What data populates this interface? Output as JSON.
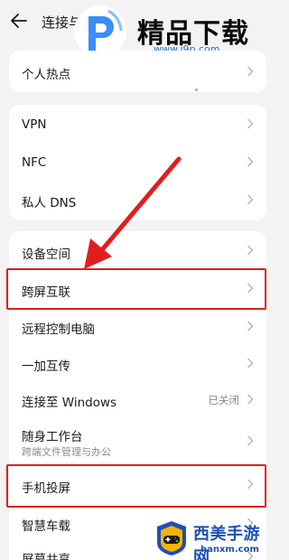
{
  "header": {
    "title": "连接与共享",
    "back_icon": "back-arrow-icon"
  },
  "watermark_top": {
    "title": "精品下载",
    "url": "www.j9p.com",
    "logo_icon": "p-logo-icon",
    "logo_color": "#3a8ef6"
  },
  "groups": [
    {
      "items": [
        {
          "label": "个人热点"
        }
      ]
    },
    {
      "items": [
        {
          "label": "VPN"
        },
        {
          "label": "NFC"
        },
        {
          "label": "私人 DNS"
        }
      ]
    },
    {
      "items": [
        {
          "label": "设备空间"
        },
        {
          "label": "跨屏互联",
          "highlighted": true
        },
        {
          "label": "远程控制电脑"
        },
        {
          "label": "一加互传"
        },
        {
          "label": "连接至 Windows",
          "value": "已关闭"
        },
        {
          "label": "随身工作台",
          "sublabel": "跨端文件管理与办公"
        },
        {
          "label": "手机投屏",
          "highlighted": true
        },
        {
          "label": "智慧车载"
        },
        {
          "label": "屏幕共享"
        }
      ]
    }
  ],
  "annotation": {
    "arrow_color": "#e21d1d",
    "highlight_color": "#e21d1d"
  },
  "watermark_bottom": {
    "title": "西美手游网",
    "url": "hanxm.com",
    "logo_icon": "gamepad-logo-icon",
    "brand_color": "#1d4fb5"
  },
  "chevron_icon": "chevron-right-icon"
}
